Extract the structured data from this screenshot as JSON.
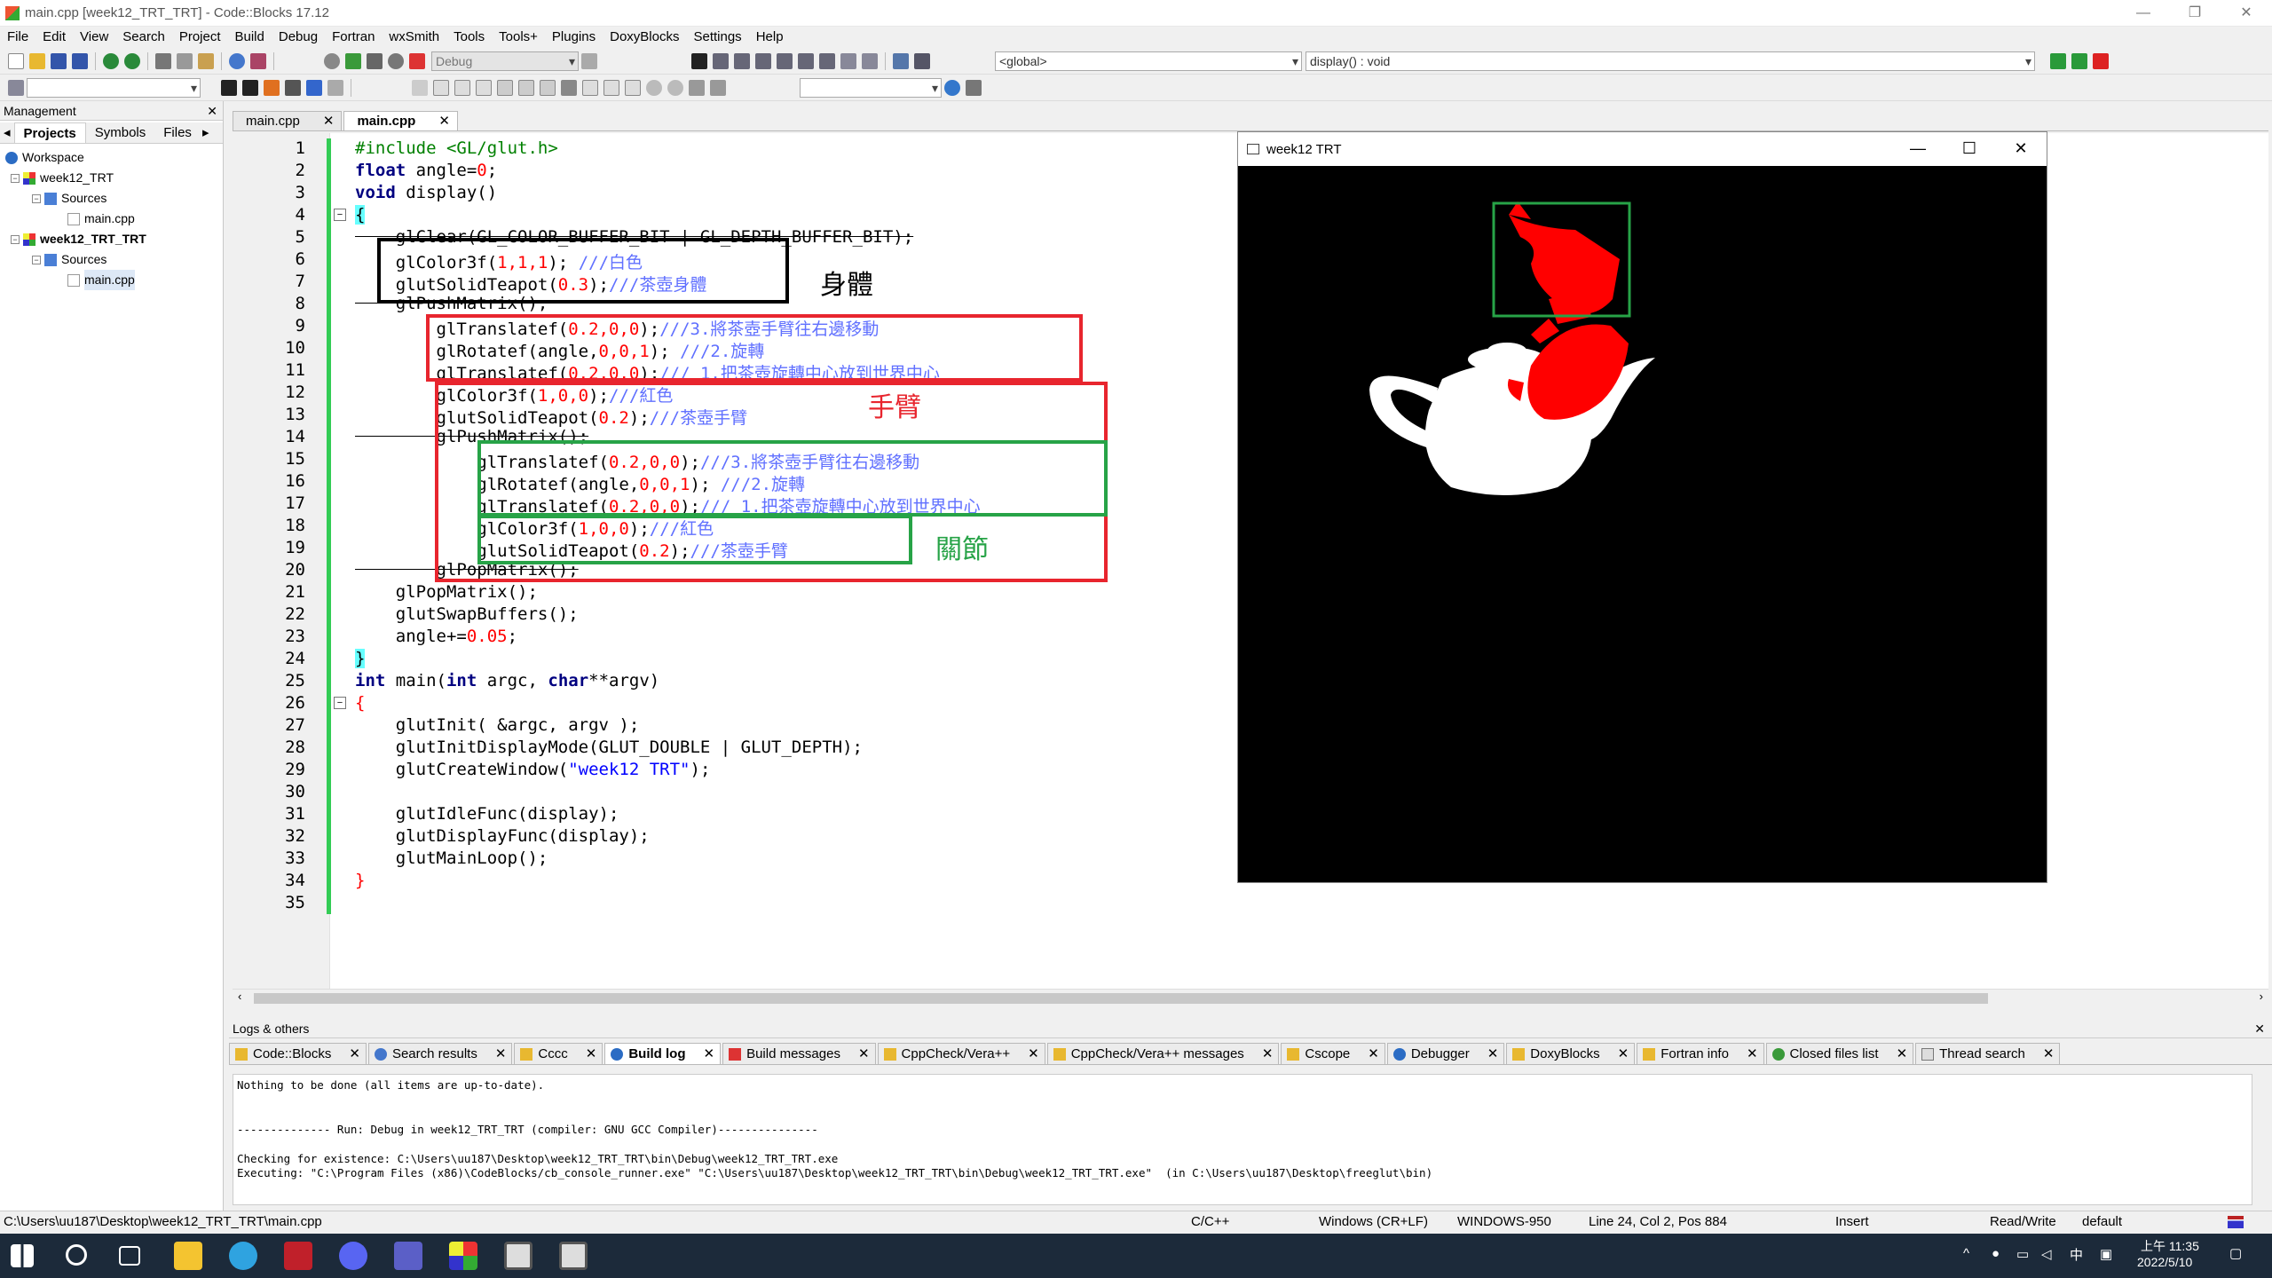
{
  "window": {
    "title": "main.cpp [week12_TRT_TRT] - Code::Blocks 17.12",
    "min": "—",
    "max": "❐",
    "close": "✕"
  },
  "menu": [
    "File",
    "Edit",
    "View",
    "Search",
    "Project",
    "Build",
    "Debug",
    "Fortran",
    "wxSmith",
    "Tools",
    "Tools+",
    "Plugins",
    "DoxyBlocks",
    "Settings",
    "Help"
  ],
  "toolbar": {
    "build_target": "Debug",
    "scope": "<global>",
    "function": "display() : void"
  },
  "management": {
    "title": "Management",
    "close": "✕",
    "tabs": [
      "Projects",
      "Symbols",
      "Files"
    ],
    "tree": {
      "workspace": "Workspace",
      "project1": "week12_TRT",
      "sources1": "Sources",
      "file1": "main.cpp",
      "project2": "week12_TRT_TRT",
      "sources2": "Sources",
      "file2": "main.cpp"
    }
  },
  "editor_tabs": [
    {
      "label": "main.cpp",
      "close": "✕"
    },
    {
      "label": "main.cpp",
      "close": "✕"
    }
  ],
  "code": {
    "l1": "#include <GL/glut.h>",
    "l2a": "float",
    "l2b": " angle=",
    "l2c": "0",
    "l2d": ";",
    "l3a": "void",
    "l3b": " display()",
    "l4": "{",
    "l5": "    glClear(GL_COLOR_BUFFER_BIT | GL_DEPTH_BUFFER_BIT);",
    "l6a": "    glColor3f(",
    "l6b": "1,1,1",
    "l6c": "); ",
    "l6d": "///白色",
    "l7a": "    glutSolidTeapot(",
    "l7b": "0.3",
    "l7c": ");",
    "l7d": "///茶壺身體",
    "l8": "    glPushMatrix();",
    "l9a": "        glTranslatef(",
    "l9b": "0.2,0,0",
    "l9c": ");",
    "l9d": "///3.將茶壺手臂往右邊移動",
    "l10a": "        glRotatef(angle,",
    "l10b": "0,0,1",
    "l10c": "); ",
    "l10d": "///2.旋轉",
    "l11a": "        glTranslatef(",
    "l11b": "0.2,0,0",
    "l11c": ");",
    "l11d": "/// 1.把茶壺旋轉中心放到世界中心",
    "l12a": "        glColor3f(",
    "l12b": "1,0,0",
    "l12c": ");",
    "l12d": "///紅色",
    "l13a": "        glutSolidTeapot(",
    "l13b": "0.2",
    "l13c": ");",
    "l13d": "///茶壺手臂",
    "l14": "        glPushMatrix();",
    "l15a": "            glTranslatef(",
    "l15b": "0.2,0,0",
    "l15c": ");",
    "l15d": "///3.將茶壺手臂往右邊移動",
    "l16a": "            glRotatef(angle,",
    "l16b": "0,0,1",
    "l16c": "); ",
    "l16d": "///2.旋轉",
    "l17a": "            glTranslatef(",
    "l17b": "0.2,0,0",
    "l17c": ");",
    "l17d": "/// 1.把茶壺旋轉中心放到世界中心",
    "l18a": "            glColor3f(",
    "l18b": "1,0,0",
    "l18c": ");",
    "l18d": "///紅色",
    "l19a": "            glutSolidTeapot(",
    "l19b": "0.2",
    "l19c": ");",
    "l19d": "///茶壺手臂",
    "l20": "        glPopMatrix();",
    "l21": "    glPopMatrix();",
    "l22": "    glutSwapBuffers();",
    "l23a": "    angle+=",
    "l23b": "0.05",
    "l23c": ";",
    "l24": "}",
    "l25a": "int",
    "l25b": " main(",
    "l25c": "int",
    "l25d": " argc, ",
    "l25e": "char",
    "l25f": "**argv)",
    "l26": "{",
    "l27": "    glutInit( &argc, argv );",
    "l28": "    glutInitDisplayMode(GLUT_DOUBLE | GLUT_DEPTH);",
    "l29a": "    glutCreateWindow(",
    "l29b": "\"week12 TRT\"",
    "l29c": ");",
    "l31": "    glutIdleFunc(display);",
    "l32": "    glutDisplayFunc(display);",
    "l33": "    glutMainLoop();",
    "l34": "}"
  },
  "annotations": {
    "body": "身體",
    "arm": "手臂",
    "joint": "關節"
  },
  "glut_window": {
    "title": "week12 TRT",
    "min": "—",
    "max": "☐",
    "close": "✕"
  },
  "logs": {
    "title": "Logs & others",
    "close": "✕",
    "tabs": [
      "Code::Blocks",
      "Search results",
      "Cccc",
      "Build log",
      "Build messages",
      "CppCheck/Vera++",
      "CppCheck/Vera++ messages",
      "Cscope",
      "Debugger",
      "DoxyBlocks",
      "Fortran info",
      "Closed files list",
      "Thread search"
    ],
    "tab_close": "✕",
    "lines": [
      "Nothing to be done (all items are up-to-date).",
      "",
      "",
      "-------------- Run: Debug in week12_TRT_TRT (compiler: GNU GCC Compiler)---------------",
      "",
      "Checking for existence: C:\\Users\\uu187\\Desktop\\week12_TRT_TRT\\bin\\Debug\\week12_TRT_TRT.exe",
      "Executing: \"C:\\Program Files (x86)\\CodeBlocks/cb_console_runner.exe\" \"C:\\Users\\uu187\\Desktop\\week12_TRT_TRT\\bin\\Debug\\week12_TRT_TRT.exe\"  (in C:\\Users\\uu187\\Desktop\\freeglut\\bin)"
    ]
  },
  "status": {
    "path": "C:\\Users\\uu187\\Desktop\\week12_TRT_TRT\\main.cpp",
    "lang": "C/C++",
    "eol": "Windows (CR+LF)",
    "encoding": "WINDOWS-950",
    "position": "Line 24, Col 2, Pos 884",
    "mode": "Insert",
    "rw": "Read/Write",
    "profile": "default"
  },
  "taskbar": {
    "time": "上午 11:35",
    "date": "2022/5/10",
    "ime": "中"
  },
  "colors": {
    "accent_green": "#33cc55",
    "box_red": "#e8252e",
    "box_green": "#27a347",
    "teapot_red": "#ff0000"
  }
}
